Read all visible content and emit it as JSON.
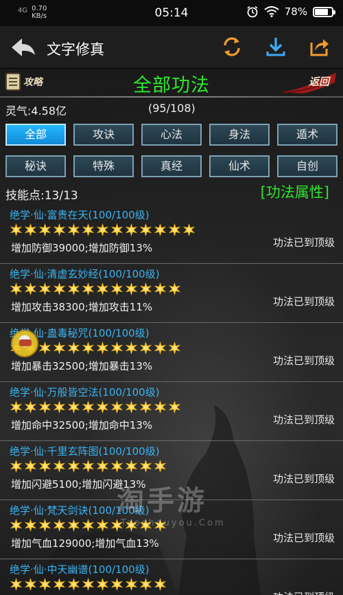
{
  "status_bar": {
    "signal": "4G",
    "speed_value": "0.70",
    "speed_unit": "KB/s",
    "time": "05:14",
    "battery_level": "78%",
    "battery_fraction": 0.78
  },
  "app_bar": {
    "title": "文字修真",
    "icons": [
      "back-arrow-icon",
      "refresh-icon",
      "download-icon",
      "share-icon"
    ]
  },
  "game_header": {
    "guide_label": "攻略",
    "page_title": "全部功法",
    "return_label": "返回"
  },
  "info": {
    "lingqi": "灵气:4.58亿",
    "count": "(95/108)"
  },
  "tabs": [
    {
      "label": "全部",
      "active": true
    },
    {
      "label": "攻诀",
      "active": false
    },
    {
      "label": "心法",
      "active": false
    },
    {
      "label": "身法",
      "active": false
    },
    {
      "label": "遁术",
      "active": false
    },
    {
      "label": "秘诀",
      "active": false
    },
    {
      "label": "特殊",
      "active": false
    },
    {
      "label": "真经",
      "active": false
    },
    {
      "label": "仙术",
      "active": false
    },
    {
      "label": "自创",
      "active": false
    }
  ],
  "skill_points": "技能点:13/13",
  "attr_button": "[功法属性]",
  "skills": [
    {
      "name": "绝学·仙·富贵在天(100/100级)",
      "stars": 13,
      "desc": "增加防御39000;增加防御13%",
      "status": "功法已到顶级"
    },
    {
      "name": "绝学·仙·清虚玄妙经(100/100级)",
      "stars": 12,
      "desc": "增加攻击38300;增加攻击11%",
      "status": "功法已到顶级"
    },
    {
      "name": "绝学·仙·蛊毒秘咒(100/100级)",
      "stars": 12,
      "desc": "增加暴击32500;增加暴击13%",
      "status": "功法已到顶级"
    },
    {
      "name": "绝学·仙·万般皆空法(100/100级)",
      "stars": 12,
      "desc": "增加命中32500;增加命中13%",
      "status": "功法已到顶级"
    },
    {
      "name": "绝学·仙·千里玄阵图(100/100级)",
      "stars": 11,
      "desc": "增加闪避5100;增加闪避13%",
      "status": "功法已到顶级"
    },
    {
      "name": "绝学·仙·梵天剑诀(100/100级)",
      "stars": 11,
      "desc": "增加气血129000;增加气血13%",
      "status": "功法已到顶级"
    },
    {
      "name": "绝学·仙·中天幽谱(100/100级)",
      "stars": 11,
      "desc": "",
      "status": "功法已到顶级"
    }
  ],
  "watermark": {
    "main": "淘手游",
    "sub": "Taoshouyou.Com"
  }
}
